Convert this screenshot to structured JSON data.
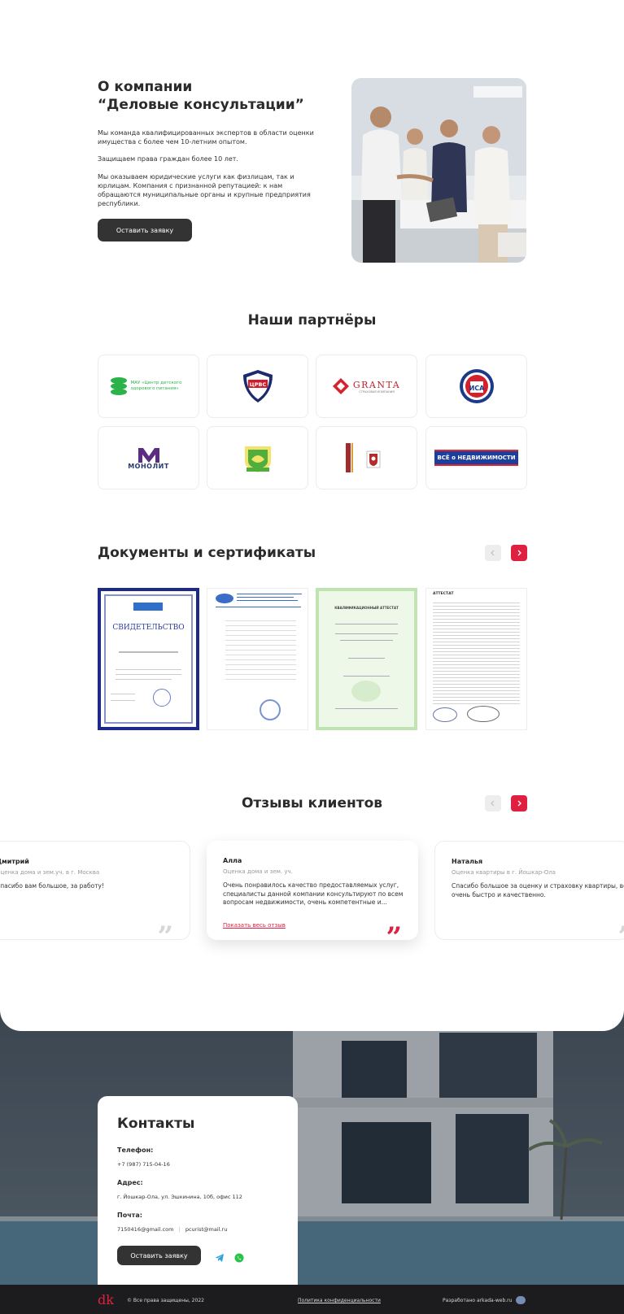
{
  "about": {
    "title_line1": "О компании",
    "title_line2": "“Деловые консультации”",
    "p1": "Мы команда квалифицированных экспертов в области оценки имущества с более чем 10-летним опытом.",
    "p2": "Защищаем права граждан более 10 лет.",
    "p3": "Мы оказываем юридические услуги как физлицам, так и юрлицам. Компания с признанной репутацией: к нам обращаются муниципальные органы и крупные предприятия республики.",
    "cta": "Оставить заявку"
  },
  "partners": {
    "title": "Наши партнёры",
    "logos": {
      "mau": "МАУ «Центр детского здорового питания»",
      "crvs": "ЦРВС",
      "granta": "GRANTA",
      "granta_sub": "СТРАХОВАЯ КОМПАНИЯ",
      "isa": "ИСА",
      "monolit": "МОНОЛИТ",
      "vse": "ВСЁ о НЕДВИЖИМОСТИ"
    }
  },
  "documents": {
    "title": "Документы и сертификаты",
    "cert1_heading": "СВИДЕТЕЛЬСТВО",
    "cert3_heading": "КВАЛИФИКАЦИОННЫЙ АТТЕСТАТ",
    "cert4_heading": "АТТЕСТАТ"
  },
  "reviews": {
    "title": "Отзывы клиентов",
    "items": [
      {
        "name": "Дмитрий",
        "location": "Оценка дома и зем.уч. в г. Москва",
        "text": "Спасибо вам большое, за работу!"
      },
      {
        "name": "Алла",
        "location": "Оценка дома и зем. уч.",
        "text": "Очень понравилось качество предоставляемых услуг, специалисты данной компании консультируют по всем вопросам недвижимости, очень компетентные и...",
        "link": "Показать весь отзыв"
      },
      {
        "name": "Наталья",
        "location": "Оценка квартиры в г. Йошкар-Ола",
        "text": "Спасибо большое за оценку и страховку квартиры, все очень быстро и качественно."
      }
    ]
  },
  "contacts": {
    "title": "Контакты",
    "phone_label": "Телефон:",
    "phone": "+7 (987) 715-04-16",
    "address_label": "Адрес:",
    "address": "г. Йошкар-Ола, ул. Эшкинина, 10б, офис 112",
    "email_label": "Почта:",
    "email1": "7150416@gmail.com",
    "email2": "pcurist@mail.ru",
    "cta": "Оставить заявку"
  },
  "footer": {
    "logo": "dk",
    "copyright": "© Все права защищены, 2022",
    "privacy": "Политика конфиденциальности",
    "dev": "Разработано arkada-web.ru"
  },
  "colors": {
    "accent": "#e02040",
    "dark": "#333333",
    "footer": "#1c1c1e"
  }
}
